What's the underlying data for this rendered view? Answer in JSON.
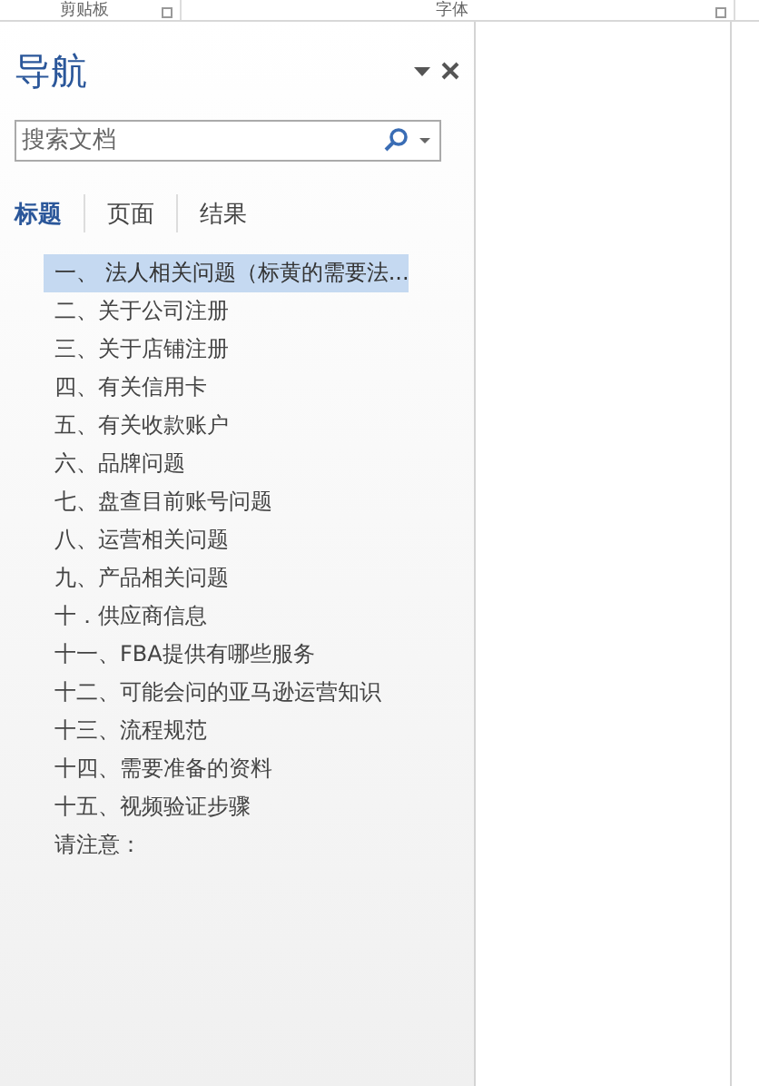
{
  "ribbon": {
    "groups": [
      {
        "label": "剪贴板"
      },
      {
        "label": "字体"
      }
    ]
  },
  "navigation": {
    "title": "导航",
    "search": {
      "placeholder": "搜索文档"
    },
    "tabs": [
      {
        "label": "标题",
        "selected": true
      },
      {
        "label": "页面",
        "selected": false
      },
      {
        "label": "结果",
        "selected": false
      }
    ],
    "headings": [
      {
        "text": "一、 法人相关问题（标黄的需要法...",
        "selected": true
      },
      {
        "text": "二、关于公司注册",
        "selected": false
      },
      {
        "text": "三、关于店铺注册",
        "selected": false
      },
      {
        "text": "四、有关信用卡",
        "selected": false
      },
      {
        "text": "五、有关收款账户",
        "selected": false
      },
      {
        "text": "六、品牌问题",
        "selected": false
      },
      {
        "text": "七、盘查目前账号问题",
        "selected": false
      },
      {
        "text": "八、运营相关问题",
        "selected": false
      },
      {
        "text": "九、产品相关问题",
        "selected": false
      },
      {
        "text": "十．供应商信息",
        "selected": false
      },
      {
        "text": "十一、FBA提供有哪些服务",
        "selected": false
      },
      {
        "text": "十二、可能会问的亚马逊运营知识",
        "selected": false
      },
      {
        "text": "十三、流程规范",
        "selected": false
      },
      {
        "text": "十四、需要准备的资料",
        "selected": false
      },
      {
        "text": "十五、视频验证步骤",
        "selected": false
      },
      {
        "text": "请注意：",
        "selected": false
      }
    ]
  }
}
